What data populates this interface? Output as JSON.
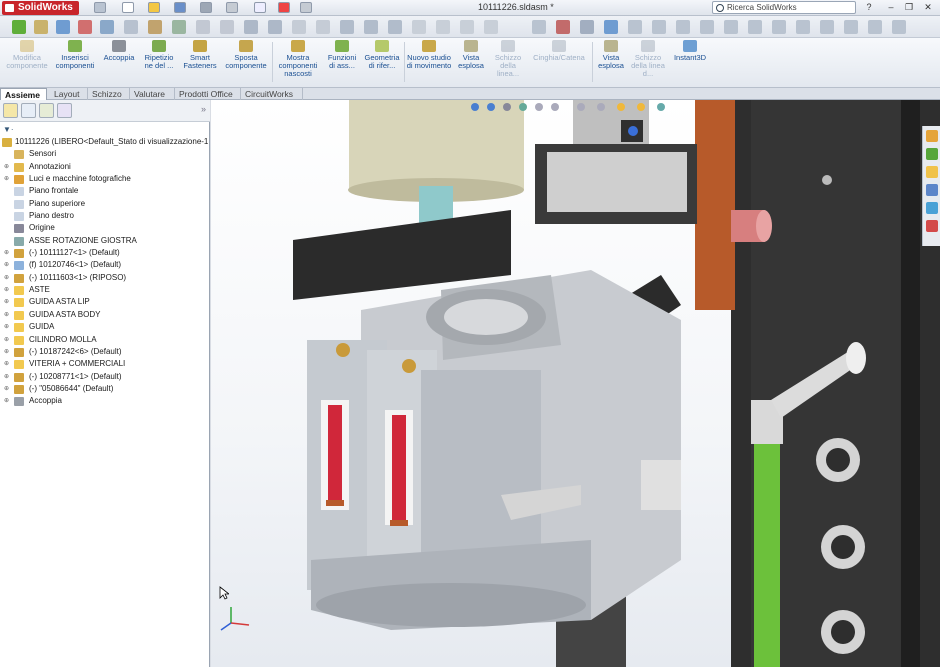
{
  "app": {
    "name": "SolidWorks",
    "file_title": "10111226.sldasm *",
    "search_placeholder": "Ricerca SolidWorks",
    "help_label": "?"
  },
  "ribbon": {
    "buttons": [
      {
        "label": "Modifica componente",
        "enabled": false
      },
      {
        "label": "Inserisci componenti",
        "enabled": true
      },
      {
        "label": "Accoppia",
        "enabled": true
      },
      {
        "label": "Ripetizio ne del ...",
        "enabled": true
      },
      {
        "label": "Smart Fasteners",
        "enabled": true
      },
      {
        "label": "Sposta componente",
        "enabled": true
      },
      {
        "label": "Mostra componenti nascosti",
        "enabled": true
      },
      {
        "label": "Funzioni di ass...",
        "enabled": true
      },
      {
        "label": "Geometria di rifer...",
        "enabled": true
      },
      {
        "label": "Nuovo studio di movimento",
        "enabled": true
      },
      {
        "label": "Vista esplosa",
        "enabled": true
      },
      {
        "label": "Schizzo della linea...",
        "enabled": false
      },
      {
        "label": "Cinghia/Catena",
        "enabled": false
      },
      {
        "label": "Vista esplosa",
        "enabled": true
      },
      {
        "label": "Schizzo della linea d...",
        "enabled": false
      },
      {
        "label": "Instant3D",
        "enabled": true
      }
    ]
  },
  "tabs": [
    {
      "label": "Assieme",
      "active": true
    },
    {
      "label": "Layout",
      "active": false
    },
    {
      "label": "Schizzo",
      "active": false
    },
    {
      "label": "Valutare",
      "active": false
    },
    {
      "label": "Prodotti Office",
      "active": false
    },
    {
      "label": "CircuitWorks",
      "active": false
    }
  ],
  "feature_tree": {
    "root": "10111226 (LIBERO<Default_Stato di visualizzazione-1",
    "items": [
      {
        "label": "Sensori",
        "icon": "sensor-icon",
        "expandable": false
      },
      {
        "label": "Annotazioni",
        "icon": "annotation-icon",
        "expandable": true
      },
      {
        "label": "Luci e macchine fotografiche",
        "icon": "lights-icon",
        "expandable": true
      },
      {
        "label": "Piano frontale",
        "icon": "plane-icon",
        "expandable": false
      },
      {
        "label": "Piano superiore",
        "icon": "plane-icon",
        "expandable": false
      },
      {
        "label": "Piano destro",
        "icon": "plane-icon",
        "expandable": false
      },
      {
        "label": "Origine",
        "icon": "origin-icon",
        "expandable": false
      },
      {
        "label": "ASSE ROTAZIONE GIOSTRA",
        "icon": "axis-icon",
        "expandable": false
      },
      {
        "label": "(-) 10111127<1> (Default)",
        "icon": "subassembly-icon",
        "expandable": true
      },
      {
        "label": "(f) 10120746<1> (Default)",
        "icon": "part-icon",
        "expandable": true
      },
      {
        "label": "(-) 10111603<1> (RIPOSO)",
        "icon": "subassembly-icon",
        "expandable": true
      },
      {
        "label": "ASTE",
        "icon": "folder-icon",
        "expandable": true
      },
      {
        "label": "GUIDA ASTA LIP",
        "icon": "folder-icon",
        "expandable": true
      },
      {
        "label": "GUIDA ASTA BODY",
        "icon": "folder-icon",
        "expandable": true
      },
      {
        "label": "GUIDA",
        "icon": "folder-icon",
        "expandable": true
      },
      {
        "label": "CILINDRO MOLLA",
        "icon": "folder-icon",
        "expandable": true
      },
      {
        "label": "(-) 10187242<6> (Default)",
        "icon": "subassembly-icon",
        "expandable": true
      },
      {
        "label": "VITERIA + COMMERCIALI",
        "icon": "folder-icon",
        "expandable": true
      },
      {
        "label": "(-) 10208771<1> (Default)",
        "icon": "subassembly-icon",
        "expandable": true
      },
      {
        "label": "(-) \"05086644\" (Default)",
        "icon": "subassembly-icon",
        "expandable": true
      },
      {
        "label": "Accoppia",
        "icon": "mates-icon",
        "expandable": true
      }
    ]
  },
  "colors": {
    "brand": "#c8252b",
    "link_blue": "#1a4f92",
    "spring_red": "#d0273a",
    "tube_green": "#6cc13b",
    "steel_light": "#cfd3d8",
    "steel_dark": "#2d2d2d",
    "copper": "#b75a2a",
    "teal_shaft": "#8fc9cb",
    "khaki": "#d8d5b9"
  }
}
